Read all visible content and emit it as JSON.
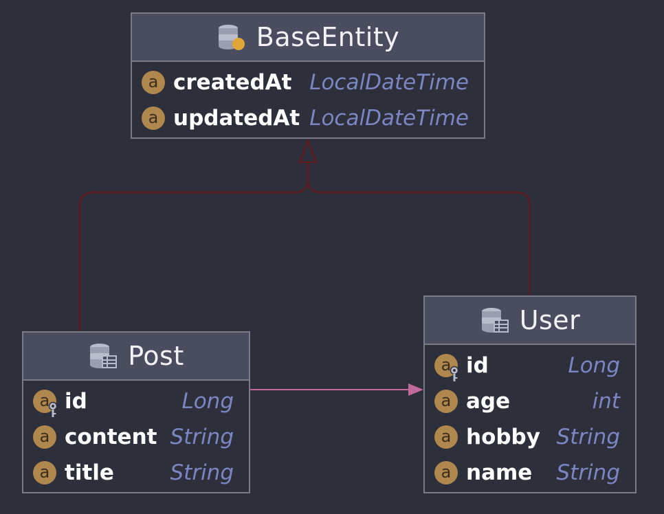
{
  "entities": {
    "base": {
      "name": "BaseEntity",
      "icon": "mapped-superclass-icon",
      "fields": [
        {
          "name": "createdAt",
          "type": "LocalDateTime"
        },
        {
          "name": "updatedAt",
          "type": "LocalDateTime"
        }
      ]
    },
    "post": {
      "name": "Post",
      "icon": "entity-table-icon",
      "fields": [
        {
          "name": "id",
          "type": "Long",
          "key": true
        },
        {
          "name": "content",
          "type": "String"
        },
        {
          "name": "title",
          "type": "String"
        }
      ]
    },
    "user": {
      "name": "User",
      "icon": "entity-table-icon",
      "fields": [
        {
          "name": "id",
          "type": "Long",
          "key": true
        },
        {
          "name": "age",
          "type": "int"
        },
        {
          "name": "hobby",
          "type": "String"
        },
        {
          "name": "name",
          "type": "String"
        }
      ]
    }
  },
  "attribute_badge": "a",
  "colors": {
    "background": "#2d2f3b",
    "header": "#4a4d5f",
    "border": "#787b88",
    "badge": "#b0874c",
    "type_text": "#7b86c2",
    "inheritance_line": "#5a1a1e",
    "association_line": "#c0699a"
  },
  "relations": [
    {
      "kind": "inheritance",
      "from": "Post",
      "to": "BaseEntity"
    },
    {
      "kind": "inheritance",
      "from": "User",
      "to": "BaseEntity"
    },
    {
      "kind": "association",
      "from": "Post",
      "to": "User"
    }
  ]
}
